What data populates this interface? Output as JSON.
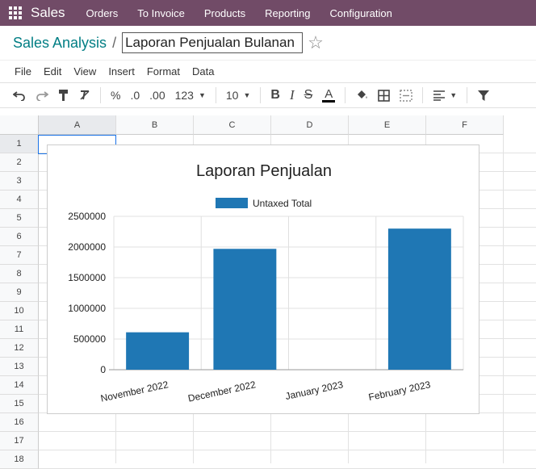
{
  "topnav": {
    "brand": "Sales",
    "items": [
      "Orders",
      "To Invoice",
      "Products",
      "Reporting",
      "Configuration"
    ]
  },
  "breadcrumb": {
    "parent": "Sales Analysis",
    "separator": "/",
    "title_value": "Laporan Penjualan Bulanan"
  },
  "menubar": [
    "File",
    "Edit",
    "View",
    "Insert",
    "Format",
    "Data"
  ],
  "toolbar": {
    "percent": "%",
    "dec_decrease": ".0",
    "dec_increase": ".00",
    "number_format": "123",
    "font_size": "10",
    "bold": "B",
    "italic": "I",
    "strike": "S",
    "text_color": "A",
    "text_color_value": "#000000",
    "icons": [
      "undo-icon",
      "redo-icon",
      "paint-format-icon",
      "clear-format-icon",
      "fill-color-icon",
      "borders-icon",
      "merge-cells-icon",
      "align-icon",
      "filter-icon"
    ]
  },
  "sheet": {
    "columns": [
      "A",
      "B",
      "C",
      "D",
      "E",
      "F"
    ],
    "rows": [
      "1",
      "2",
      "3",
      "4",
      "5",
      "6",
      "7",
      "8",
      "9",
      "10",
      "11",
      "12",
      "13",
      "14",
      "15",
      "16",
      "17",
      "18"
    ],
    "selected_cell": "A1"
  },
  "colors": {
    "brand": "#714B67",
    "accent": "#017e84",
    "series": "#1f77b4"
  },
  "chart_data": {
    "type": "bar",
    "title": "Laporan Penjualan",
    "categories": [
      "November 2022",
      "December 2022",
      "January 2023",
      "February 2023"
    ],
    "series": [
      {
        "name": "Untaxed Total",
        "values": [
          610000,
          1970000,
          0,
          2300000
        ],
        "color": "#1f77b4"
      }
    ],
    "xlabel": "",
    "ylabel": "",
    "ylim": [
      0,
      2500000
    ],
    "yticks": [
      "0",
      "500000",
      "1000000",
      "1500000",
      "2000000",
      "2500000"
    ],
    "grid": true,
    "legend": "top"
  }
}
